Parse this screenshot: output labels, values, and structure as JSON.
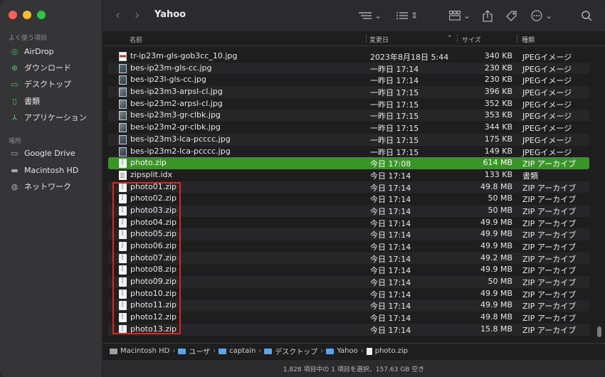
{
  "window": {
    "title": "Yahoo"
  },
  "sidebar": {
    "favorites_label": "よく使う項目",
    "locations_label": "場所",
    "favorites": [
      {
        "label": "AirDrop",
        "icon": "airdrop-icon"
      },
      {
        "label": "ダウンロード",
        "icon": "download-icon"
      },
      {
        "label": "デスクトップ",
        "icon": "desktop-icon"
      },
      {
        "label": "書類",
        "icon": "document-icon"
      },
      {
        "label": "アプリケーション",
        "icon": "applications-icon"
      }
    ],
    "locations": [
      {
        "label": "Google Drive",
        "icon": "folder-icon"
      },
      {
        "label": "Macintosh HD",
        "icon": "harddisk-icon"
      },
      {
        "label": "ネットワーク",
        "icon": "network-icon"
      }
    ]
  },
  "columns": {
    "name": "名前",
    "date": "変更日",
    "size": "サイズ",
    "kind": "種類"
  },
  "files": [
    {
      "name": "tr-ip23m-gls-gob3cc_10.jpg",
      "date": "2023年8月18日 5:44",
      "size": "340 KB",
      "kind": "JPEGイメージ",
      "icon": "image-red"
    },
    {
      "name": "bes-ip23m-gls-cc.jpg",
      "date": "一昨日 17:14",
      "size": "230 KB",
      "kind": "JPEGイメージ",
      "icon": "image"
    },
    {
      "name": "bes-ip23l-gls-cc.jpg",
      "date": "一昨日 17:14",
      "size": "230 KB",
      "kind": "JPEGイメージ",
      "icon": "image"
    },
    {
      "name": "bes-ip23m3-arpsl-cl.jpg",
      "date": "一昨日 17:15",
      "size": "396 KB",
      "kind": "JPEGイメージ",
      "icon": "image2"
    },
    {
      "name": "bes-ip23m2-arpsl-cl.jpg",
      "date": "一昨日 17:15",
      "size": "352 KB",
      "kind": "JPEGイメージ",
      "icon": "image2"
    },
    {
      "name": "bes-ip23m3-gr-clbk.jpg",
      "date": "一昨日 17:15",
      "size": "353 KB",
      "kind": "JPEGイメージ",
      "icon": "image2"
    },
    {
      "name": "bes-ip23m2-gr-clbk.jpg",
      "date": "一昨日 17:15",
      "size": "344 KB",
      "kind": "JPEGイメージ",
      "icon": "image2"
    },
    {
      "name": "bes-ip23m3-lca-pcccc.jpg",
      "date": "一昨日 17:15",
      "size": "175 KB",
      "kind": "JPEGイメージ",
      "icon": "image"
    },
    {
      "name": "bes-ip23m2-lca-pcccc.jpg",
      "date": "一昨日 17:15",
      "size": "149 KB",
      "kind": "JPEGイメージ",
      "icon": "image"
    },
    {
      "name": "photo.zip",
      "date": "今日 17:08",
      "size": "614 MB",
      "kind": "ZIP アーカイブ",
      "icon": "zip",
      "selected": true
    },
    {
      "name": "zipsplit.idx",
      "date": "今日 17:14",
      "size": "133 KB",
      "kind": "書類",
      "icon": "doc"
    },
    {
      "name": "photo01.zip",
      "date": "今日 17:14",
      "size": "49.8 MB",
      "kind": "ZIP アーカイブ",
      "icon": "zip"
    },
    {
      "name": "photo02.zip",
      "date": "今日 17:14",
      "size": "50 MB",
      "kind": "ZIP アーカイブ",
      "icon": "zip"
    },
    {
      "name": "photo03.zip",
      "date": "今日 17:14",
      "size": "50 MB",
      "kind": "ZIP アーカイブ",
      "icon": "zip"
    },
    {
      "name": "photo04.zip",
      "date": "今日 17:14",
      "size": "49.9 MB",
      "kind": "ZIP アーカイブ",
      "icon": "zip"
    },
    {
      "name": "photo05.zip",
      "date": "今日 17:14",
      "size": "49.9 MB",
      "kind": "ZIP アーカイブ",
      "icon": "zip"
    },
    {
      "name": "photo06.zip",
      "date": "今日 17:14",
      "size": "49.9 MB",
      "kind": "ZIP アーカイブ",
      "icon": "zip"
    },
    {
      "name": "photo07.zip",
      "date": "今日 17:14",
      "size": "49.2 MB",
      "kind": "ZIP アーカイブ",
      "icon": "zip"
    },
    {
      "name": "photo08.zip",
      "date": "今日 17:14",
      "size": "49.9 MB",
      "kind": "ZIP アーカイブ",
      "icon": "zip"
    },
    {
      "name": "photo09.zip",
      "date": "今日 17:14",
      "size": "50 MB",
      "kind": "ZIP アーカイブ",
      "icon": "zip"
    },
    {
      "name": "photo10.zip",
      "date": "今日 17:14",
      "size": "49.9 MB",
      "kind": "ZIP アーカイブ",
      "icon": "zip"
    },
    {
      "name": "photo11.zip",
      "date": "今日 17:14",
      "size": "49.9 MB",
      "kind": "ZIP アーカイブ",
      "icon": "zip"
    },
    {
      "name": "photo12.zip",
      "date": "今日 17:14",
      "size": "49.8 MB",
      "kind": "ZIP アーカイブ",
      "icon": "zip"
    },
    {
      "name": "photo13.zip",
      "date": "今日 17:14",
      "size": "15.8 MB",
      "kind": "ZIP アーカイブ",
      "icon": "zip"
    }
  ],
  "pathbar": [
    {
      "label": "Macintosh HD",
      "icon": "harddisk"
    },
    {
      "label": "ユーザ",
      "icon": "folder"
    },
    {
      "label": "captain",
      "icon": "folder"
    },
    {
      "label": "デスクトップ",
      "icon": "folder"
    },
    {
      "label": "Yahoo",
      "icon": "folder"
    },
    {
      "label": "photo.zip",
      "icon": "zip"
    }
  ],
  "status": "1,828 項目中の 1 項目を選択、157.63 GB 空き",
  "colors": {
    "selection": "#389625",
    "highlight_box": "#e4231b",
    "accent_green": "#46c35c"
  }
}
